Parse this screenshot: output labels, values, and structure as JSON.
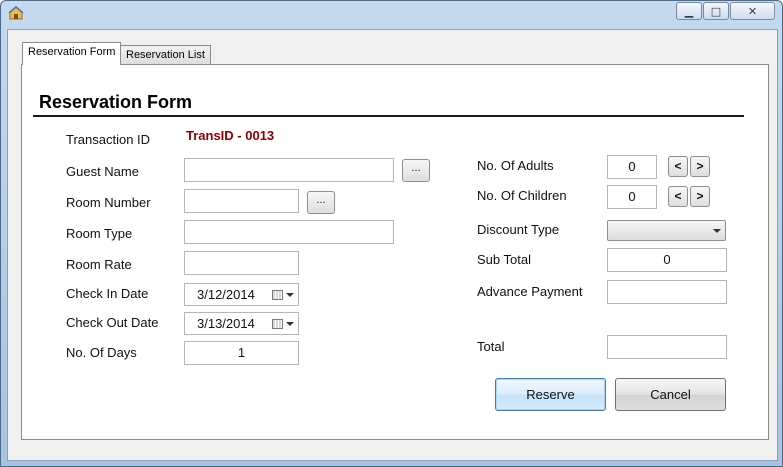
{
  "window": {
    "title": ""
  },
  "tabs": [
    {
      "label": "Reservation Form",
      "active": true
    },
    {
      "label": "Reservation List",
      "active": false
    }
  ],
  "form": {
    "header": "Reservation Form",
    "transaction_id": {
      "label": "Transaction ID",
      "value": "TransID - 0013"
    },
    "guest_name": {
      "label": "Guest Name",
      "value": "",
      "browse": "..."
    },
    "room_number": {
      "label": "Room Number",
      "value": "",
      "browse": "..."
    },
    "room_type": {
      "label": "Room Type",
      "value": ""
    },
    "room_rate": {
      "label": "Room Rate",
      "value": ""
    },
    "check_in": {
      "label": "Check In Date",
      "value": "3/12/2014"
    },
    "check_out": {
      "label": "Check Out Date",
      "value": "3/13/2014"
    },
    "no_of_days": {
      "label": "No. Of Days",
      "value": "1"
    },
    "no_of_adults": {
      "label": "No. Of Adults",
      "value": "0",
      "dec": "<",
      "inc": ">"
    },
    "no_of_children": {
      "label": "No. Of Children",
      "value": "0",
      "dec": "<",
      "inc": ">"
    },
    "discount_type": {
      "label": "Discount Type",
      "value": ""
    },
    "sub_total": {
      "label": "Sub Total",
      "value": "0"
    },
    "advance_payment": {
      "label": "Advance Payment",
      "value": ""
    },
    "total": {
      "label": "Total",
      "value": ""
    },
    "buttons": {
      "reserve": "Reserve",
      "cancel": "Cancel"
    }
  },
  "colors": {
    "transaction_value": "#8b0000",
    "title_bar": "#b9cfe8"
  }
}
